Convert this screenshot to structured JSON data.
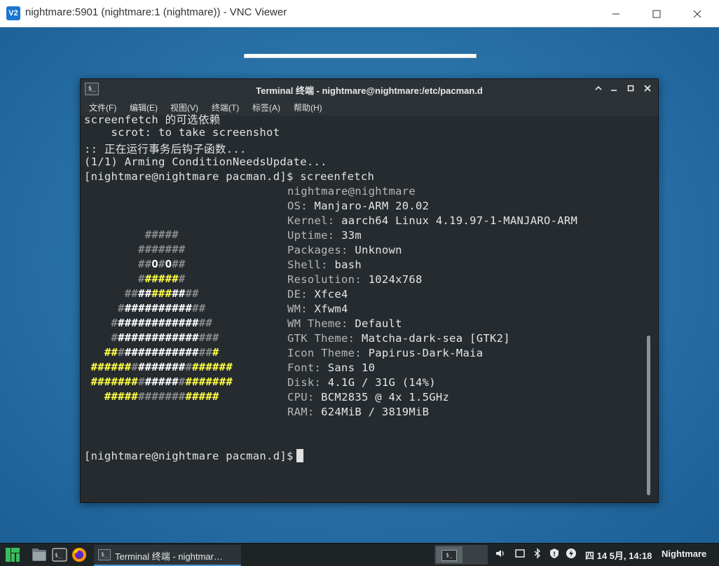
{
  "vnc": {
    "title": "nightmare:5901 (nightmare:1 (nightmare)) - VNC Viewer",
    "logo": "V2",
    "minimize_icon": "minimize-icon",
    "maximize_icon": "maximize-icon",
    "close_icon": "close-icon"
  },
  "terminal": {
    "title": "Terminal 终端 - nightmare@nightmare:/etc/pacman.d",
    "app_icon": "$_",
    "menu": [
      "文件(F)",
      "编辑(E)",
      "视图(V)",
      "终端(T)",
      "标签(A)",
      "帮助(H)"
    ],
    "lines": [
      "screenfetch 的可选依赖",
      "    scrot: to take screenshot",
      ":: 正在运行事务后钩子函数...",
      "(1/1) Arming ConditionNeedsUpdate...",
      "[nightmare@nightmare pacman.d]$ screenfetch"
    ],
    "info_header": "nightmare@nightmare",
    "info": [
      {
        "key": "OS: ",
        "value": "Manjaro-ARM 20.02"
      },
      {
        "key": "Kernel: ",
        "value": "aarch64 Linux 4.19.97-1-MANJARO-ARM"
      },
      {
        "key": "Uptime: ",
        "value": "33m"
      },
      {
        "key": "Packages: ",
        "value": "Unknown"
      },
      {
        "key": "Shell: ",
        "value": "bash"
      },
      {
        "key": "Resolution: ",
        "value": "1024x768"
      },
      {
        "key": "DE: ",
        "value": "Xfce4"
      },
      {
        "key": "WM: ",
        "value": "Xfwm4"
      },
      {
        "key": "WM Theme: ",
        "value": "Default"
      },
      {
        "key": "GTK Theme: ",
        "value": "Matcha-dark-sea [GTK2]"
      },
      {
        "key": "Icon Theme: ",
        "value": "Papirus-Dark-Maia"
      },
      {
        "key": "Font: ",
        "value": "Sans 10"
      },
      {
        "key": "Disk: ",
        "value": "4.1G / 31G (14%)"
      },
      {
        "key": "CPU: ",
        "value": "BCM2835 @ 4x 1.5GHz"
      },
      {
        "key": "RAM: ",
        "value": "624MiB / 3819MiB"
      }
    ],
    "prompt": "[nightmare@nightmare pacman.d]$",
    "ascii": [
      "         #####",
      "        #######",
      "        ##O#O##",
      "        #######",
      "      ###########",
      "     #############",
      "    ###############",
      "    ################",
      "   #################",
      " #####################",
      " #####################",
      "   #################"
    ],
    "colors": {
      "bg": "#252b2f",
      "text": "#e3e3e3",
      "tux_yellow": "#ffff44",
      "tux_gray": "#8a8a8a"
    }
  },
  "taskbar": {
    "task_label": "Terminal 终端 - nightmar…",
    "task_icon": "$_",
    "clock": "四 14 5月, 14:18",
    "user": "Nightmare",
    "launchers": [
      "manjaro-menu-icon",
      "file-manager-icon",
      "terminal-icon",
      "firefox-icon"
    ],
    "tray": [
      "volume-icon",
      "window-icon",
      "bluetooth-icon",
      "update-icon",
      "power-icon"
    ]
  }
}
